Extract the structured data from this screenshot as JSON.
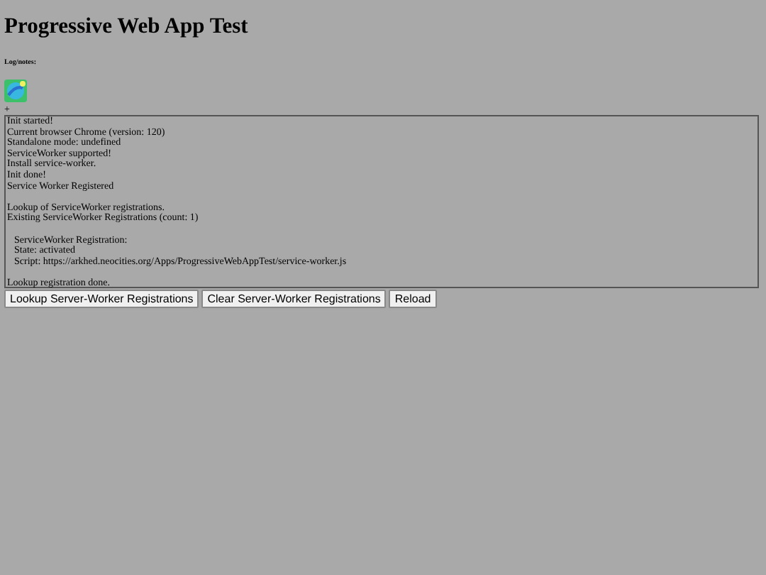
{
  "title": "Progressive Web App Test",
  "log_heading": "Log/notes:",
  "plus": "+",
  "log_blocks": [
    {
      "kind": "plain",
      "lines": [
        "Init started!",
        "Current browser Chrome (version: 120)",
        "Standalone mode: undefined",
        "ServiceWorker supported!",
        "Install service-worker.",
        "Init done!",
        "Service Worker Registered"
      ]
    },
    {
      "kind": "plain",
      "lines": [
        "Lookup of ServiceWorker registrations.",
        "Existing ServiceWorker Registrations (count: 1)"
      ]
    },
    {
      "kind": "indented",
      "lines": [
        "ServiceWorker Registration:",
        "State: activated",
        "Script: https://arkhed.neocities.org/Apps/ProgressiveWebAppTest/service-worker.js"
      ]
    },
    {
      "kind": "plain",
      "lines": [
        "Lookup registration done."
      ]
    }
  ],
  "buttons": [
    "Lookup Server-Worker Registrations",
    "Clear Server-Worker Registrations",
    "Reload"
  ]
}
